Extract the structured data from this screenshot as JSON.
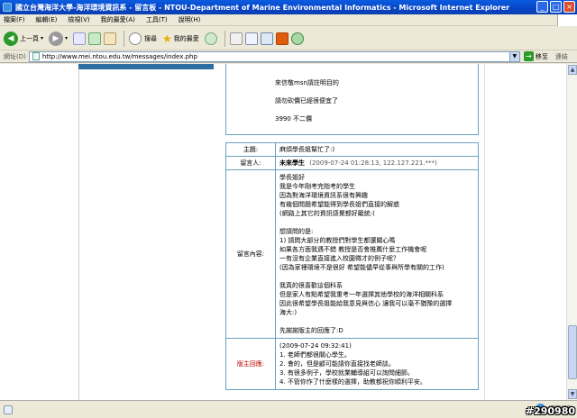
{
  "window": {
    "title": "國立台灣海洋大學-海洋環境資訊系 - 留言板 - NTOU-Department of Marine Environmental Informatics - Microsoft Internet Explorer"
  },
  "menu": [
    "檔案(F)",
    "編輯(E)",
    "檢視(V)",
    "我的最愛(A)",
    "工具(T)",
    "說明(H)"
  ],
  "toolbar": {
    "back_label": "上一頁",
    "search_label": "搜尋",
    "favorites_label": "我的最愛"
  },
  "address": {
    "label": "網址(D)",
    "url": "http://www.mei.ntou.edu.tw/messages/index.php",
    "go_label": "移至",
    "links_label": "連結"
  },
  "prev_post": {
    "lines": [
      "來信敬msn請註明目的",
      "請勿砍價已經很便宜了",
      "3990 不二價"
    ]
  },
  "post": {
    "subject_label": "主題:",
    "subject": "麻煩學長姐幫忙了:)",
    "author_label": "留言人:",
    "author_name": "未來學生",
    "author_meta": "(2009-07-24 01:28:13, 122.127.221.***)",
    "content_label": "留言內容:",
    "content_lines": [
      "學長姐好",
      "我是今年剛考完指考的學生",
      "因為對海洋環境資訊系很有興趣",
      "有幾個問題希望能得到學長姐們直接的解惑",
      "(網路上其它的資訊感覺都好籠統:(",
      "",
      "想請問的是:",
      "1) 請問大部分的教授們對學生都還關心嗎",
      "如果各方面我遇不錯 教授是否會推薦什麼工作機會呢",
      "一有沒有企業直接進入校園徵才的例子呢？",
      "(因為家裡環境不是很好 希望能儘早從事與所學有關的工作)",
      "",
      "我真的很喜歡這個科系",
      "但是家人有點希望我重考一年選擇其他學校的海洋相關科系",
      "因此很希望學長姐能給我意見與信心 讓我可以毫不猶豫的選擇",
      "海大:)",
      "",
      "先謝謝版主的回應了:D"
    ],
    "reply_label": "版主回應:",
    "reply_lines": [
      "(2009-07-24 09:32:41)",
      "1. 老師們都很關心學生。",
      "2. 會的，但是顧可能請你直接找老師談。",
      "3. 有很多例子，學校就業輔導組可以詢問細節。",
      "4. 不管你作了什麼樣的選擇，助教都祝你順利平安。"
    ]
  },
  "status": {
    "zone_label": "網際網路",
    "watermark": "#290980"
  }
}
